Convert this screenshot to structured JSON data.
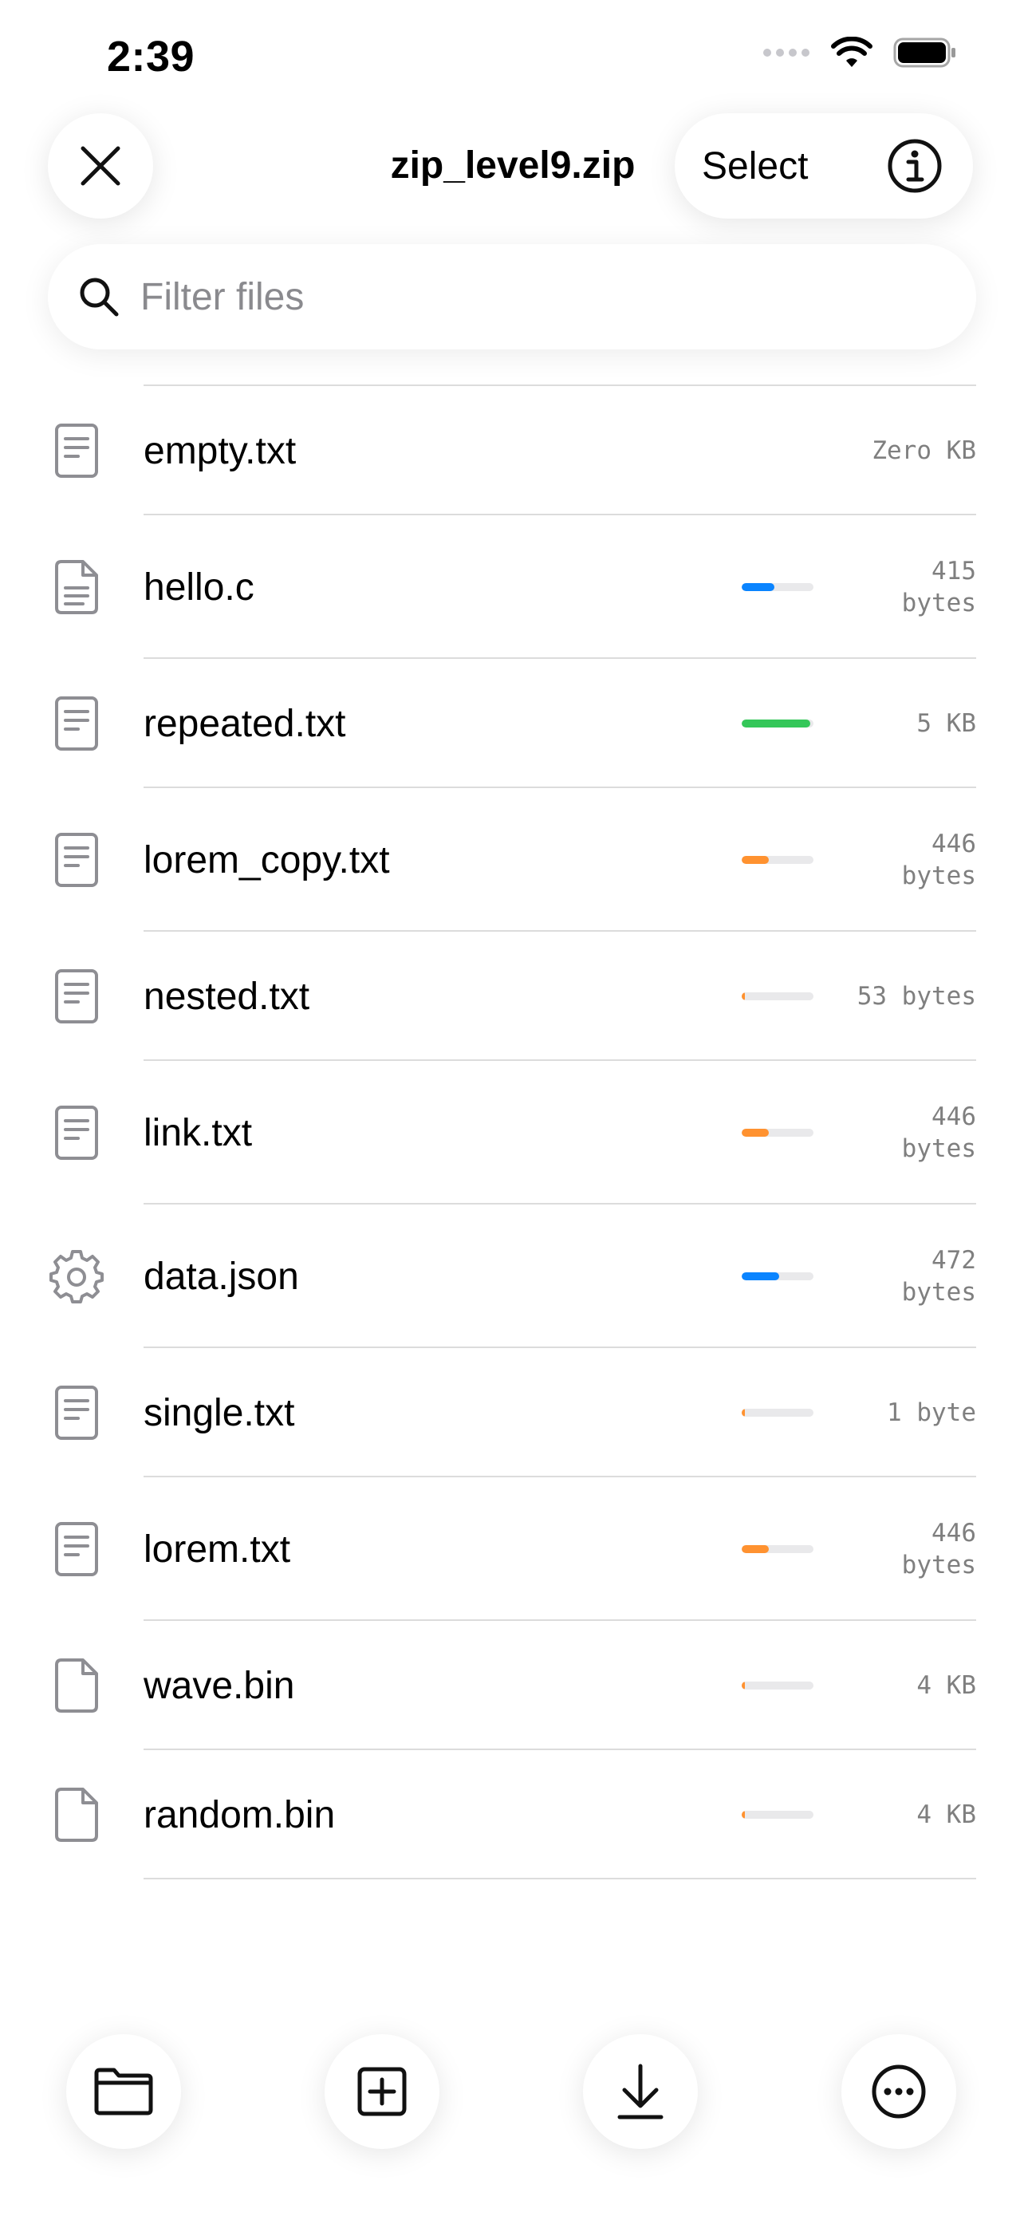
{
  "status_bar": {
    "time": "2:39"
  },
  "nav": {
    "title": "zip_level9.zip",
    "select_label": "Select"
  },
  "search": {
    "placeholder": "Filter files",
    "value": ""
  },
  "colors": {
    "blue": "#0a84ff",
    "green": "#34c759",
    "orange": "#ff9230",
    "track": "#e9e9eb"
  },
  "files": [
    {
      "name": "empty.txt",
      "size": "Zero KB",
      "icon": "text-file-icon",
      "ratio": null,
      "color": ""
    },
    {
      "name": "hello.c",
      "size": "415 bytes",
      "icon": "code-file-icon",
      "ratio": 0.45,
      "color": "#0a84ff"
    },
    {
      "name": "repeated.txt",
      "size": "5 KB",
      "icon": "text-file-icon",
      "ratio": 0.96,
      "color": "#34c759"
    },
    {
      "name": "lorem_copy.txt",
      "size": "446 bytes",
      "icon": "text-file-icon",
      "ratio": 0.38,
      "color": "#ff9230"
    },
    {
      "name": "nested.txt",
      "size": "53 bytes",
      "icon": "text-file-icon",
      "ratio": 0.03,
      "color": "#ff9230"
    },
    {
      "name": "link.txt",
      "size": "446 bytes",
      "icon": "text-file-icon",
      "ratio": 0.38,
      "color": "#ff9230"
    },
    {
      "name": "data.json",
      "size": "472 bytes",
      "icon": "gear-icon",
      "ratio": 0.52,
      "color": "#0a84ff"
    },
    {
      "name": "single.txt",
      "size": "1 byte",
      "icon": "text-file-icon",
      "ratio": 0.03,
      "color": "#ff9230"
    },
    {
      "name": "lorem.txt",
      "size": "446 bytes",
      "icon": "text-file-icon",
      "ratio": 0.38,
      "color": "#ff9230"
    },
    {
      "name": "wave.bin",
      "size": "4 KB",
      "icon": "blank-file-icon",
      "ratio": 0.03,
      "color": "#ff9230"
    },
    {
      "name": "random.bin",
      "size": "4 KB",
      "icon": "blank-file-icon",
      "ratio": 0.03,
      "color": "#ff9230"
    }
  ],
  "toolbar": {
    "items": [
      "folder-icon",
      "add-square-icon",
      "download-icon",
      "more-icon"
    ]
  }
}
